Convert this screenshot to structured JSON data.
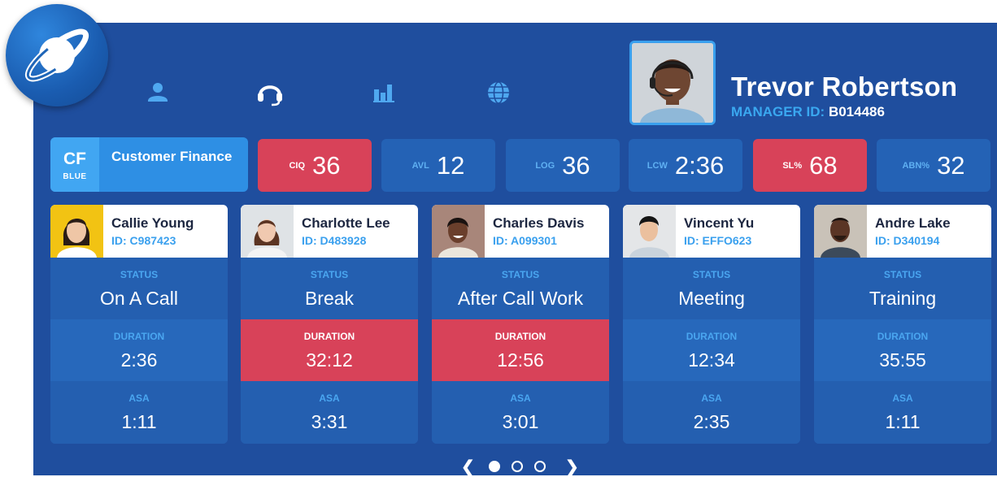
{
  "manager": {
    "name": "Trevor Robertson",
    "id_label": "MANAGER ID:",
    "id_value": "B014486"
  },
  "nav": {
    "icons": [
      "user-icon",
      "headset-icon",
      "bar-chart-icon",
      "globe-icon"
    ]
  },
  "team": {
    "code": "CF",
    "color": "BLUE",
    "name": "Customer Finance"
  },
  "stats": [
    {
      "label": "CIQ",
      "value": "36",
      "alert": true
    },
    {
      "label": "AVL",
      "value": "12",
      "alert": false
    },
    {
      "label": "LOG",
      "value": "36",
      "alert": false
    },
    {
      "label": "LCW",
      "value": "2:36",
      "alert": false
    },
    {
      "label": "SL%",
      "value": "68",
      "alert": true
    },
    {
      "label": "ABN%",
      "value": "32",
      "alert": false
    }
  ],
  "agents": [
    {
      "name": "Callie Young",
      "id": "ID: C987423",
      "status_label": "STATUS",
      "status": "On A Call",
      "duration_label": "DURATION",
      "duration": "2:36",
      "asa_label": "ASA",
      "asa": "1:11",
      "alert": false
    },
    {
      "name": "Charlotte Lee",
      "id": "ID: D483928",
      "status_label": "STATUS",
      "status": "Break",
      "duration_label": "DURATION",
      "duration": "32:12",
      "asa_label": "ASA",
      "asa": "3:31",
      "alert": true
    },
    {
      "name": "Charles Davis",
      "id": "ID: A099301",
      "status_label": "STATUS",
      "status": "After Call Work",
      "duration_label": "DURATION",
      "duration": "12:56",
      "asa_label": "ASA",
      "asa": "3:01",
      "alert": true
    },
    {
      "name": "Vincent Yu",
      "id": "ID: EFFO623",
      "status_label": "STATUS",
      "status": "Meeting",
      "duration_label": "DURATION",
      "duration": "12:34",
      "asa_label": "ASA",
      "asa": "2:35",
      "alert": false
    },
    {
      "name": "Andre Lake",
      "id": "ID: D340194",
      "status_label": "STATUS",
      "status": "Training",
      "duration_label": "DURATION",
      "duration": "35:55",
      "asa_label": "ASA",
      "asa": "1:11",
      "alert": false
    }
  ],
  "pager": {
    "pages": 3,
    "current": 1
  },
  "colors": {
    "panel": "#1f4e9e",
    "card": "#2462b5",
    "alert": "#d84259",
    "accent": "#3aa0ee"
  }
}
